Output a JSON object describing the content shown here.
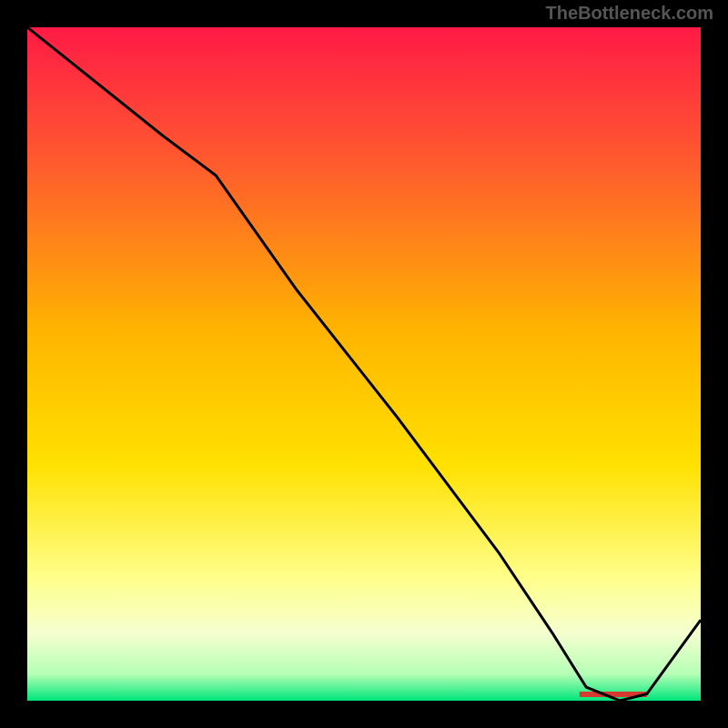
{
  "watermark": "TheBottleneck.com",
  "chart_data": {
    "type": "line",
    "title": "",
    "xlabel": "",
    "ylabel": "",
    "xlim": [
      0,
      100
    ],
    "ylim": [
      0,
      100
    ],
    "x": [
      0,
      10,
      20,
      28,
      40,
      55,
      70,
      78,
      83,
      88,
      92,
      100
    ],
    "values": [
      100,
      92,
      84,
      78,
      61,
      42,
      22,
      10,
      2,
      0,
      1,
      12
    ],
    "optimal_band": {
      "start": 82,
      "end": 92
    },
    "gradient_stops": [
      {
        "offset": 0,
        "color": "#ff1a46"
      },
      {
        "offset": 20,
        "color": "#ff5a2e"
      },
      {
        "offset": 45,
        "color": "#ffb400"
      },
      {
        "offset": 65,
        "color": "#ffe100"
      },
      {
        "offset": 82,
        "color": "#ffff8c"
      },
      {
        "offset": 90,
        "color": "#f5ffd0"
      },
      {
        "offset": 96,
        "color": "#b6ffb6"
      },
      {
        "offset": 100,
        "color": "#00e67a"
      }
    ],
    "marker_color": "#d43a2f"
  }
}
